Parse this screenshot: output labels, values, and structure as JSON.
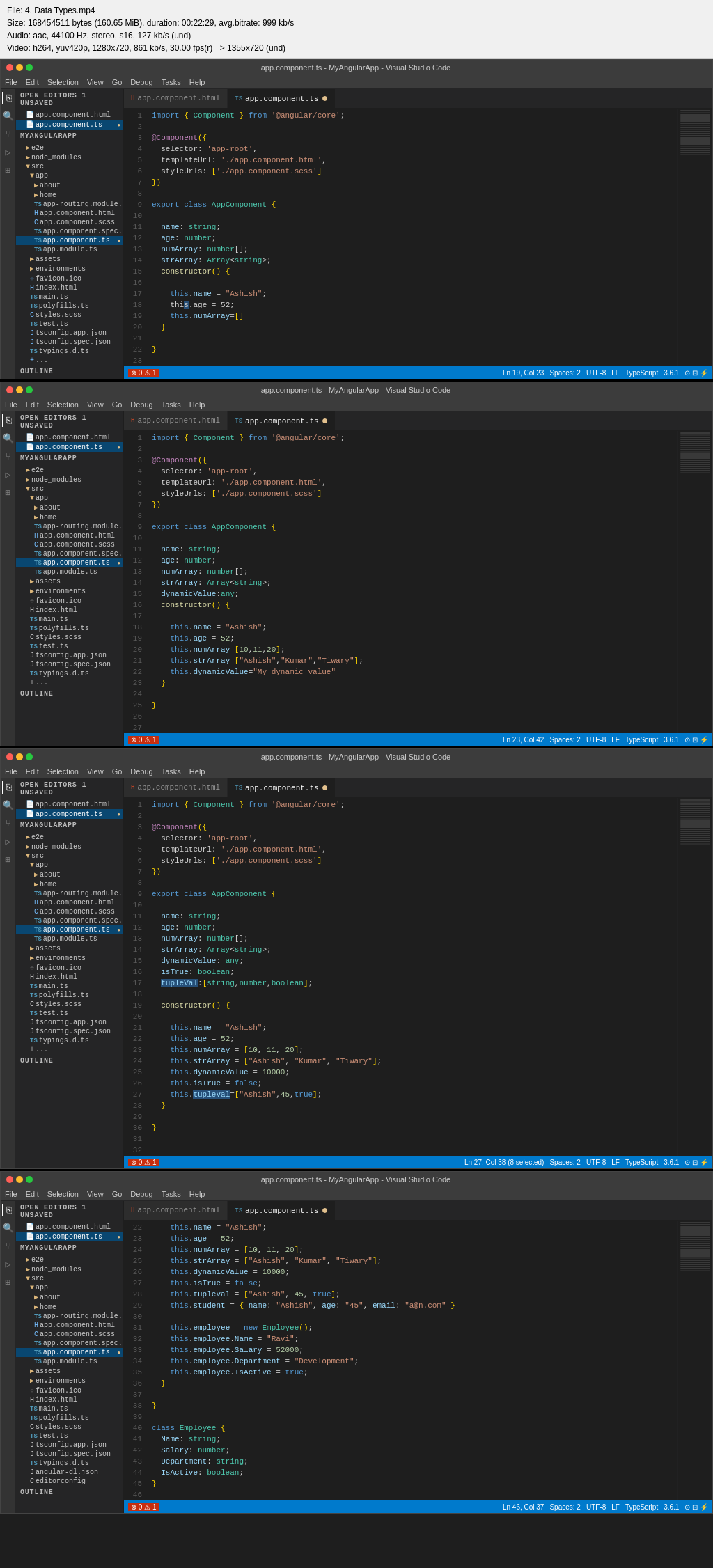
{
  "videoInfo": {
    "line1": "File: 4. Data Types.mp4",
    "line2": "Size: 168454511 bytes (160.65 MiB), duration: 00:22:29, avg.bitrate: 999 kb/s",
    "line3": "Audio: aac, 44100 Hz, stereo, s16, 127 kb/s (und)",
    "line4": "Video: h264, yuv420p, 1280x720, 861 kb/s, 30.00 fps(r) => 1355x720 (und)"
  },
  "windows": [
    {
      "title": "app.component.ts - MyAngularApp - Visual Studio Code",
      "tabs": [
        {
          "label": "app.component.html",
          "active": false,
          "modified": false
        },
        {
          "label": "app.component.ts",
          "active": true,
          "modified": true
        }
      ],
      "statusBar": {
        "errors": "0",
        "warnings": "1",
        "line": "Ln 19, Col 23",
        "spaces": "Spaces: 2",
        "encoding": "UTF-8",
        "lineending": "LF",
        "language": "TypeScript",
        "version": "3.6.1"
      }
    },
    {
      "title": "app.component.ts - MyAngularApp - Visual Studio Code",
      "tabs": [
        {
          "label": "app.component.html",
          "active": false,
          "modified": false
        },
        {
          "label": "app.component.ts",
          "active": true,
          "modified": true
        }
      ],
      "statusBar": {
        "errors": "0",
        "warnings": "1",
        "line": "Ln 23, Col 42",
        "spaces": "Spaces: 2",
        "encoding": "UTF-8",
        "lineending": "LF",
        "language": "TypeScript",
        "version": "3.6.1"
      }
    },
    {
      "title": "app.component.ts - MyAngularApp - Visual Studio Code",
      "tabs": [
        {
          "label": "app.component.html",
          "active": false,
          "modified": false
        },
        {
          "label": "app.component.ts",
          "active": true,
          "modified": true
        }
      ],
      "statusBar": {
        "errors": "0",
        "warnings": "1",
        "line": "Ln 27, Col 38 (8 selected)",
        "spaces": "Spaces: 2",
        "encoding": "UTF-8",
        "lineending": "LF",
        "language": "TypeScript",
        "version": "3.6.1"
      }
    },
    {
      "title": "app.component.ts - MyAngularApp - Visual Studio Code",
      "tabs": [
        {
          "label": "app.component.html",
          "active": false,
          "modified": false
        },
        {
          "label": "app.component.ts",
          "active": true,
          "modified": true
        }
      ],
      "statusBar": {
        "errors": "0",
        "warnings": "1",
        "line": "Ln 46, Col 37",
        "spaces": "Spaces: 2",
        "encoding": "UTF-8",
        "lineending": "LF",
        "language": "TypeScript",
        "version": "3.6.1"
      }
    }
  ],
  "menus": [
    "File",
    "Edit",
    "Selection",
    "View",
    "Go",
    "Debug",
    "Tasks",
    "Help"
  ],
  "sidebar": {
    "sections": {
      "openEditors": "OPEN EDITORS  1 UNSAVED",
      "explorer": "MYANGULARAPP"
    }
  }
}
